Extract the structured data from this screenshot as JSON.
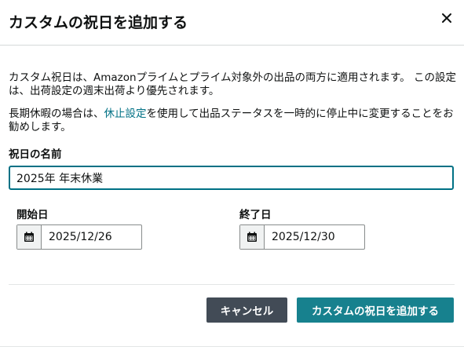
{
  "dialog": {
    "title": "カスタムの祝日を追加する",
    "close_icon": "close-icon"
  },
  "description": {
    "line1": "カスタム祝日は、Amazonプライムとプライム対象外の出品の両方に適用されます。 この設定は、出荷設定の週末出荷より優先されます。",
    "line2_before": "長期休暇の場合は、",
    "line2_link": "休止設定",
    "line2_after": "を使用して出品ステータスを一時的に停止中に変更することをお勧めします。"
  },
  "holiday_name": {
    "label": "祝日の名前",
    "value": "2025年 年末休業"
  },
  "start_date": {
    "label": "開始日",
    "value": "2025/12/26",
    "icon": "calendar-icon"
  },
  "end_date": {
    "label": "終了日",
    "value": "2025/12/30",
    "icon": "calendar-icon"
  },
  "buttons": {
    "cancel": "キャンセル",
    "submit": "カスタムの祝日を追加する"
  },
  "colors": {
    "accent": "#007185",
    "primary_button": "#17818e",
    "secondary_button": "#424b56"
  }
}
